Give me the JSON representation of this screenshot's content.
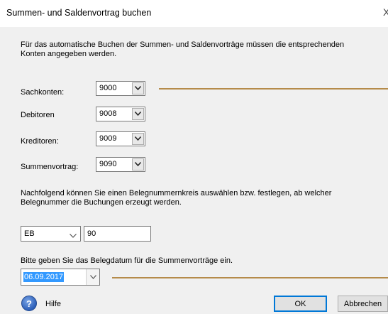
{
  "window": {
    "title": "Summen- und Saldenvortrag buchen",
    "close_glyph": "X"
  },
  "intro_text_line1": "Für das automatische Buchen der Summen- und Saldenvorträge müssen die entsprechenden",
  "intro_text_line2": "Konten angegeben werden.",
  "accounts": [
    {
      "label": "Sachkonten:",
      "value": "9000"
    },
    {
      "label": "Debitoren",
      "value": "9008"
    },
    {
      "label": "Kreditoren:",
      "value": "9009"
    },
    {
      "label": "Summenvortrag:",
      "value": "9090"
    }
  ],
  "belegnummer_text_line1": "Nachfolgend können Sie einen Belegnummernkreis auswählen bzw. festlegen, ab welcher",
  "belegnummer_text_line2": "Belegnummer die Buchungen erzeugt werden.",
  "belegkreis": {
    "selected": "EB",
    "number": "90"
  },
  "datum_text": "Bitte geben Sie das Belegdatum für die Summenvorträge ein.",
  "belegdatum": {
    "value": "06.09.2017"
  },
  "footer": {
    "help_label": "Hilfe",
    "help_glyph": "?",
    "ok_label": "OK",
    "cancel_label": "Abbrechen"
  },
  "colors": {
    "accent_line": "#b58b4a",
    "selection": "#3399ff",
    "default_button_border": "#0078d7"
  },
  "icons": [
    "close-icon",
    "chevron-down-icon",
    "help-icon"
  ]
}
